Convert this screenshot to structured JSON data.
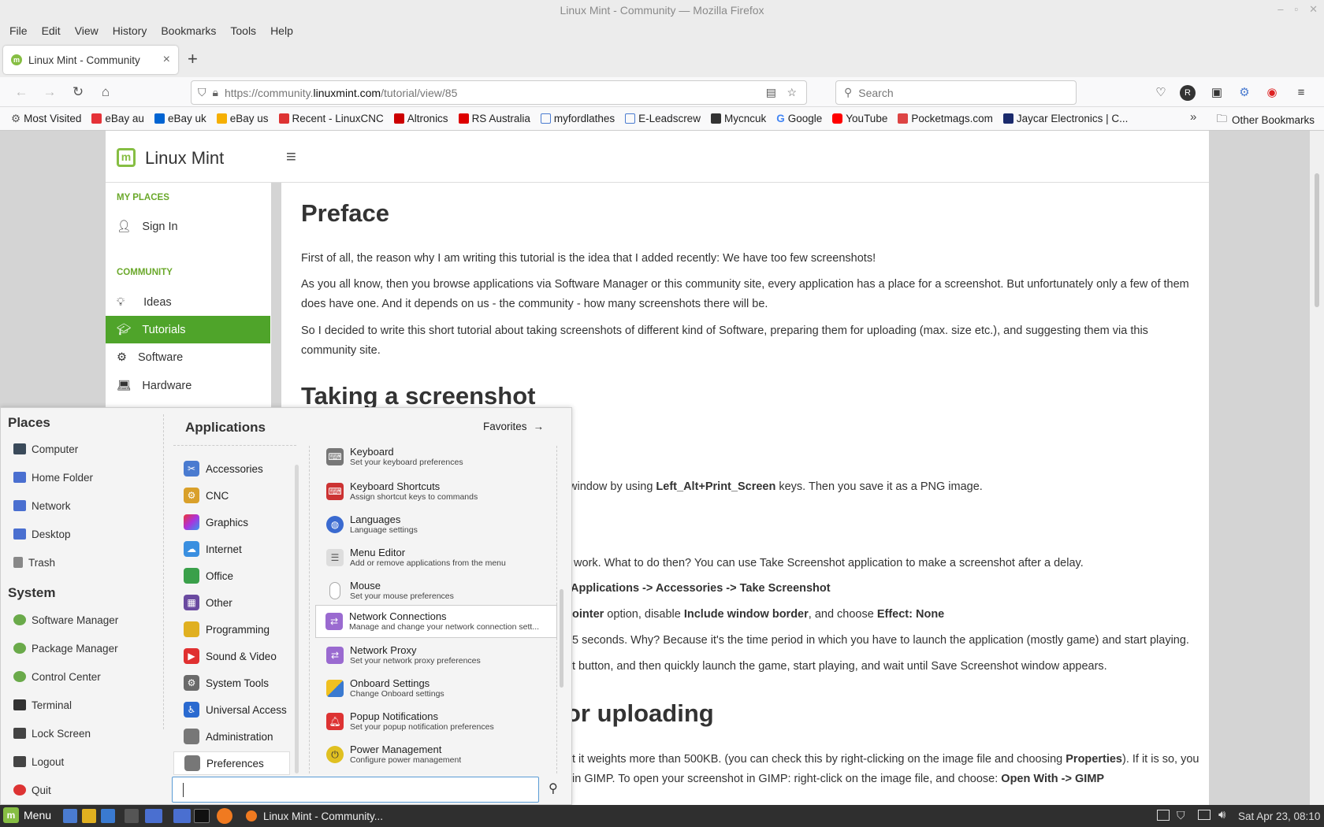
{
  "window": {
    "title": "Linux Mint - Community — Mozilla Firefox"
  },
  "menubar": [
    "File",
    "Edit",
    "View",
    "History",
    "Bookmarks",
    "Tools",
    "Help"
  ],
  "tab": {
    "title": "Linux Mint - Community",
    "close": "×",
    "new": "+"
  },
  "url": {
    "prefix": "https://community.",
    "domain": "linuxmint.com",
    "path": "/tutorial/view/85"
  },
  "search": {
    "placeholder": "Search"
  },
  "bookmarks": [
    {
      "label": "Most Visited",
      "color": "#555"
    },
    {
      "label": "eBay au",
      "color": "#e53238"
    },
    {
      "label": "eBay uk",
      "color": "#0064d2"
    },
    {
      "label": "eBay us",
      "color": "#f5af02"
    },
    {
      "label": "Recent - LinuxCNC",
      "color": "#d33"
    },
    {
      "label": "Altronics",
      "color": "#c00"
    },
    {
      "label": "RS Australia",
      "color": "#d00"
    },
    {
      "label": "myfordlathes",
      "color": "#4a7bd0"
    },
    {
      "label": "E-Leadscrew",
      "color": "#4a7bd0"
    },
    {
      "label": "Mycncuk",
      "color": "#333"
    },
    {
      "label": "Google",
      "color": "#4285f4"
    },
    {
      "label": "YouTube",
      "color": "#f00"
    },
    {
      "label": "Pocketmags.com",
      "color": "#d44"
    },
    {
      "label": "Jaycar Electronics | C...",
      "color": "#1a2a6c"
    }
  ],
  "other_bookmarks": "Other Bookmarks",
  "site": {
    "brand": "Linux Mint",
    "my_places": "MY PLACES",
    "sign_in": "Sign In",
    "community": "COMMUNITY",
    "nav": [
      "Ideas",
      "Tutorials",
      "Software",
      "Hardware"
    ]
  },
  "article": {
    "h_preface": "Preface",
    "p1": "First of all, the reason why I am writing this tutorial is the idea that I added recently: We have too few screenshots!",
    "p2": "As you all know, then you browse applications via Software Manager or this community site, every application has a place for a screenshot. But unfortunately  only a few of them does have one. And it depends on us - the community - how many screenshots there will be.",
    "p3": "So I decided to write this short tutorial about taking screenshots of different kind of Software, preparing them for uploading (max. size etc.), and suggesting them via this community site.",
    "h_taking": "Taking a screenshot",
    "l1a": "window by using ",
    "l1b": "Left_Alt+Print_Screen",
    "l1c": " keys. Then you save it as a PNG image.",
    "l2": "work. What to do then? You can use Take Screenshot application to make a screenshot after a delay.",
    "l3": "Applications -> Accessories -> Take Screenshot",
    "l4a": "ointer",
    "l4b": " option, disable ",
    "l4c": "Include window border",
    "l4d": ", and choose ",
    "l4e": "Effect: None",
    "l5": "5 seconds. Why? Because it's the time period in which you have to launch the application (mostly game) and start playing.",
    "l6": "t button, and then quickly launch the game, start playing, and wait until Save Screenshot window appears.",
    "h_upload": "or uploading",
    "l7a": "t it weights more than 500KB. (you can check this by right-clicking on the image file and choosing ",
    "l7b": "Properties",
    "l7c": "). If it is so, you",
    "l8a": "in GIMP. To open your screenshot in GIMP: right-click on the image file, and choose: ",
    "l8b": "Open With -> GIMP"
  },
  "menu": {
    "places_title": "Places",
    "places": [
      "Computer",
      "Home Folder",
      "Network",
      "Desktop",
      "Trash"
    ],
    "system_title": "System",
    "system": [
      "Software Manager",
      "Package Manager",
      "Control Center",
      "Terminal",
      "Lock Screen",
      "Logout",
      "Quit"
    ],
    "apps_title": "Applications",
    "favorites": "Favorites",
    "categories": [
      "Accessories",
      "CNC",
      "Graphics",
      "Internet",
      "Office",
      "Other",
      "Programming",
      "Sound & Video",
      "System Tools",
      "Universal Access",
      "Administration",
      "Preferences"
    ],
    "apps": [
      {
        "name": "Keyboard",
        "desc": "Set your keyboard preferences"
      },
      {
        "name": "Keyboard Shortcuts",
        "desc": "Assign shortcut keys to commands"
      },
      {
        "name": "Languages",
        "desc": "Language settings"
      },
      {
        "name": "Menu Editor",
        "desc": "Add or remove applications from the menu"
      },
      {
        "name": "Mouse",
        "desc": "Set your mouse preferences"
      },
      {
        "name": "Network Connections",
        "desc": "Manage and change your network connection sett..."
      },
      {
        "name": "Network Proxy",
        "desc": "Set your network proxy preferences"
      },
      {
        "name": "Onboard Settings",
        "desc": "Change Onboard settings"
      },
      {
        "name": "Popup Notifications",
        "desc": "Set your popup notification preferences"
      },
      {
        "name": "Power Management",
        "desc": "Configure power management"
      }
    ]
  },
  "taskbar": {
    "menu": "Menu",
    "window": "Linux Mint - Community...",
    "clock": "Sat Apr 23, 08:10"
  }
}
